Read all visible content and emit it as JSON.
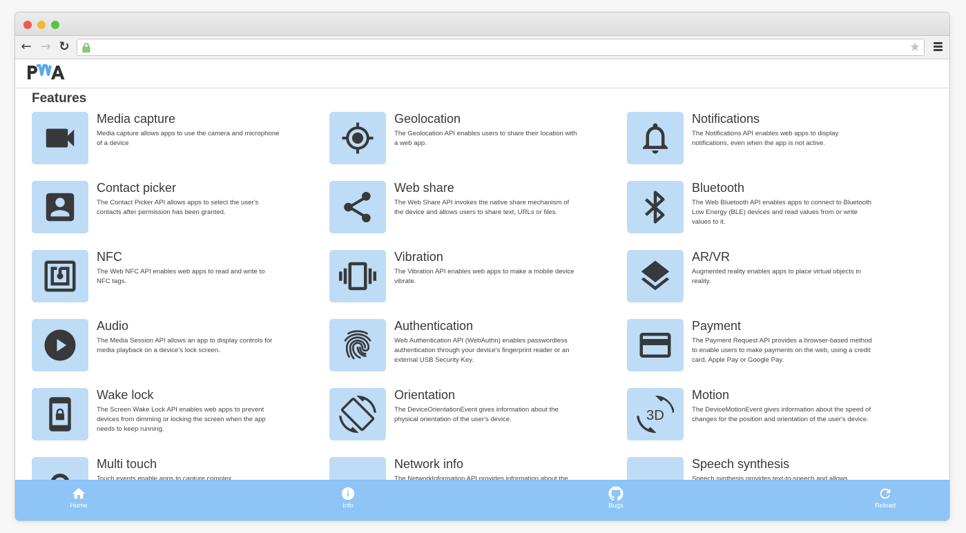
{
  "browser": {
    "url": "",
    "traffic_lights": [
      "close",
      "minimize",
      "zoom"
    ]
  },
  "app": {
    "logo_text": "PWA",
    "section_title": "Features"
  },
  "features": [
    {
      "title": "Media capture",
      "description": "Media capture allows apps to use the camera and microphone of a device",
      "icon": "videocam-icon"
    },
    {
      "title": "Geolocation",
      "description": "The Geolocation API enables users to share their location with a web app.",
      "icon": "gps-target-icon"
    },
    {
      "title": "Notifications",
      "description": "The Notifications API enables web apps to display notifications, even when the app is not active.",
      "icon": "bell-icon"
    },
    {
      "title": "Contact picker",
      "description": "The Contact Picker API allows apps to select the user's contacts after permission has been granted.",
      "icon": "contact-icon"
    },
    {
      "title": "Web share",
      "description": "The Web Share API invokes the native share mechanism of the device and allows users to share text, URLs or files.",
      "icon": "share-icon"
    },
    {
      "title": "Bluetooth",
      "description": "The Web Bluetooth API enables apps to connect to Bluetooth Low Energy (BLE) devices and read values from or write values to it.",
      "icon": "bluetooth-icon"
    },
    {
      "title": "NFC",
      "description": "The Web NFC API enables web apps to read and write to NFC tags.",
      "icon": "nfc-icon"
    },
    {
      "title": "Vibration",
      "description": "The Vibration API enables web apps to make a mobile device vibrate.",
      "icon": "vibration-icon"
    },
    {
      "title": "AR/VR",
      "description": "Augmented reality enables apps to place virtual objects in reality.",
      "icon": "layers-icon"
    },
    {
      "title": "Audio",
      "description": "The Media Session API allows an app to display controls for media playback on a device's lock screen.",
      "icon": "play-circle-icon"
    },
    {
      "title": "Authentication",
      "description": "Web Authentication API (WebAuthn) enables passwordless authentication through your device's fingerprint reader or an external USB Security Key.",
      "icon": "fingerprint-icon"
    },
    {
      "title": "Payment",
      "description": "The Payment Request API provides a browser-based method to enable users to make payments on the web, using a credit card, Apple Pay or Google Pay.",
      "icon": "credit-card-icon"
    },
    {
      "title": "Wake lock",
      "description": "The Screen Wake Lock API enables web apps to prevent devices from dimming or locking the screen when the app needs to keep running.",
      "icon": "phone-lock-icon"
    },
    {
      "title": "Orientation",
      "description": "The DeviceOrientationEvent gives information about the physical orientation of the user's device.",
      "icon": "screen-rotation-icon"
    },
    {
      "title": "Motion",
      "description": "The DeviceMotionEvent gives information about the speed of changes for the position and orientation of the user's device.",
      "icon": "3d-rotation-icon"
    },
    {
      "title": "Multi touch",
      "description": "Touch events enable apps to capture complex",
      "icon": "touch-icon"
    },
    {
      "title": "Network info",
      "description": "The NetworkInformation API provides information about the",
      "icon": "speed-gauge-icon"
    },
    {
      "title": "Speech synthesis",
      "description": "Speech synthesis provides text-to-speech and allows",
      "icon": "speech-icon"
    }
  ],
  "bottom_nav": [
    {
      "label": "Home",
      "icon": "home-icon"
    },
    {
      "label": "Info",
      "icon": "info-icon"
    },
    {
      "label": "Bugs",
      "icon": "github-icon"
    },
    {
      "label": "Reload",
      "icon": "reload-icon"
    }
  ],
  "colors": {
    "icon_tile": "#bedcf5",
    "icon_fg": "#37393b",
    "bottom_nav_bg": "#8ec5f6",
    "logo_accent": "#5aa9ee"
  }
}
